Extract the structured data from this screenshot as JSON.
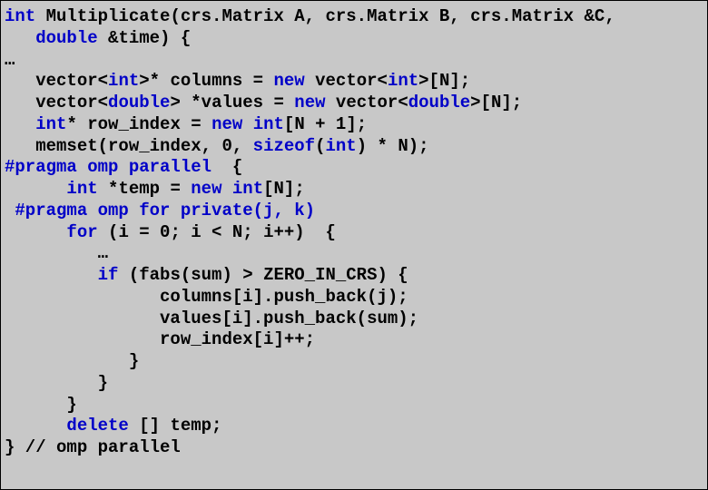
{
  "code": {
    "lines": [
      {
        "indent": 0,
        "segments": [
          {
            "cls": "kw",
            "t": "int"
          },
          {
            "cls": "plain",
            "t": " Multiplicate(crs.Matrix A, crs.Matrix B, crs.Matrix &C,"
          }
        ]
      },
      {
        "indent": 1,
        "segments": [
          {
            "cls": "kw",
            "t": "double"
          },
          {
            "cls": "plain",
            "t": " &time) {"
          }
        ]
      },
      {
        "indent": 0,
        "segments": [
          {
            "cls": "plain",
            "t": "…"
          }
        ]
      },
      {
        "indent": 1,
        "segments": [
          {
            "cls": "plain",
            "t": "vector<"
          },
          {
            "cls": "kw",
            "t": "int"
          },
          {
            "cls": "plain",
            "t": ">* columns = "
          },
          {
            "cls": "kw",
            "t": "new"
          },
          {
            "cls": "plain",
            "t": " vector<"
          },
          {
            "cls": "kw",
            "t": "int"
          },
          {
            "cls": "plain",
            "t": ">[N];"
          }
        ]
      },
      {
        "indent": 1,
        "segments": [
          {
            "cls": "plain",
            "t": "vector<"
          },
          {
            "cls": "kw",
            "t": "double"
          },
          {
            "cls": "plain",
            "t": "> *values = "
          },
          {
            "cls": "kw",
            "t": "new"
          },
          {
            "cls": "plain",
            "t": " vector<"
          },
          {
            "cls": "kw",
            "t": "double"
          },
          {
            "cls": "plain",
            "t": ">[N];"
          }
        ]
      },
      {
        "indent": 1,
        "segments": [
          {
            "cls": "kw",
            "t": "int"
          },
          {
            "cls": "plain",
            "t": "* row_index = "
          },
          {
            "cls": "kw",
            "t": "new"
          },
          {
            "cls": "plain",
            "t": " "
          },
          {
            "cls": "kw",
            "t": "int"
          },
          {
            "cls": "plain",
            "t": "[N + 1];"
          }
        ]
      },
      {
        "indent": 1,
        "segments": [
          {
            "cls": "plain",
            "t": "memset(row_index, 0, "
          },
          {
            "cls": "kw",
            "t": "sizeof"
          },
          {
            "cls": "plain",
            "t": "("
          },
          {
            "cls": "kw",
            "t": "int"
          },
          {
            "cls": "plain",
            "t": ") * N);"
          }
        ]
      },
      {
        "indent": 0,
        "segments": [
          {
            "cls": "kw",
            "t": "#pragma omp parallel"
          },
          {
            "cls": "plain",
            "t": "  {"
          }
        ]
      },
      {
        "indent": 2,
        "segments": [
          {
            "cls": "kw",
            "t": "int"
          },
          {
            "cls": "plain",
            "t": " *temp = "
          },
          {
            "cls": "kw",
            "t": "new"
          },
          {
            "cls": "plain",
            "t": " "
          },
          {
            "cls": "kw",
            "t": "int"
          },
          {
            "cls": "plain",
            "t": "[N];"
          }
        ]
      },
      {
        "indent": 0,
        "segments": [
          {
            "cls": "plain",
            "t": " "
          },
          {
            "cls": "kw",
            "t": "#pragma omp for private(j, k)"
          }
        ]
      },
      {
        "indent": 2,
        "segments": [
          {
            "cls": "kw",
            "t": "for"
          },
          {
            "cls": "plain",
            "t": " (i = 0; i < N; i++)  {"
          }
        ]
      },
      {
        "indent": 3,
        "segments": [
          {
            "cls": "plain",
            "t": "…"
          }
        ]
      },
      {
        "indent": 3,
        "segments": [
          {
            "cls": "kw",
            "t": "if"
          },
          {
            "cls": "plain",
            "t": " (fabs(sum) > ZERO_IN_CRS) {"
          }
        ]
      },
      {
        "indent": 5,
        "segments": [
          {
            "cls": "plain",
            "t": "columns[i].push_back(j);"
          }
        ]
      },
      {
        "indent": 5,
        "segments": [
          {
            "cls": "plain",
            "t": "values[i].push_back(sum);"
          }
        ]
      },
      {
        "indent": 5,
        "segments": [
          {
            "cls": "plain",
            "t": "row_index[i]++;"
          }
        ]
      },
      {
        "indent": 4,
        "segments": [
          {
            "cls": "plain",
            "t": "}"
          }
        ]
      },
      {
        "indent": 3,
        "segments": [
          {
            "cls": "plain",
            "t": "}"
          }
        ]
      },
      {
        "indent": 2,
        "segments": [
          {
            "cls": "plain",
            "t": "}"
          }
        ]
      },
      {
        "indent": 2,
        "segments": [
          {
            "cls": "kw",
            "t": "delete"
          },
          {
            "cls": "plain",
            "t": " [] temp;"
          }
        ]
      },
      {
        "indent": 0,
        "segments": [
          {
            "cls": "plain",
            "t": "} // omp parallel"
          }
        ]
      }
    ]
  }
}
